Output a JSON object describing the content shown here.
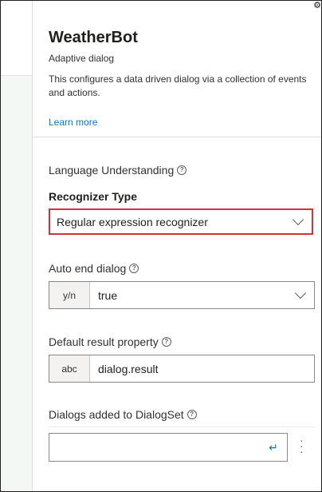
{
  "corner_icon": "settings-icon",
  "header": {
    "title": "WeatherBot",
    "subtitle": "Adaptive dialog",
    "description": "This configures a data driven dialog via a collection of events and actions.",
    "learn_more": "Learn more"
  },
  "language_understanding": {
    "section_label": "Language Understanding",
    "recognizer_label": "Recognizer Type",
    "recognizer_value": "Regular expression recognizer"
  },
  "auto_end_dialog": {
    "label": "Auto end dialog",
    "type_badge": "y/n",
    "value": "true"
  },
  "default_result_property": {
    "label": "Default result property",
    "type_badge": "abc",
    "value": "dialog.result"
  },
  "dialogs_added": {
    "label": "Dialogs added to DialogSet",
    "input_value": ""
  },
  "colors": {
    "accent": "#0078d4",
    "highlight_border": "#d13438"
  }
}
